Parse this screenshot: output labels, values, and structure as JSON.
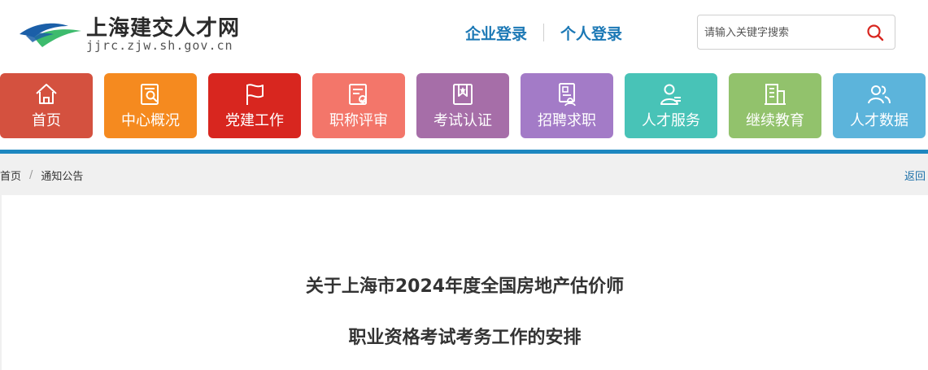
{
  "site": {
    "title": "上海建交人才网",
    "domain": "jjrc.zjw.sh.gov.cn"
  },
  "header": {
    "enterprise_login": "企业登录",
    "personal_login": "个人登录",
    "search_placeholder": "请输入关键字搜索"
  },
  "nav": {
    "items": [
      {
        "label": "首页",
        "icon": "home-icon",
        "color": "#d4513f"
      },
      {
        "label": "中心概况",
        "icon": "document-search-icon",
        "color": "#f58a1f"
      },
      {
        "label": "党建工作",
        "icon": "flag-icon",
        "color": "#d8261f"
      },
      {
        "label": "职称评审",
        "icon": "certificate-icon",
        "color": "#f3766a"
      },
      {
        "label": "考试认证",
        "icon": "badge-star-icon",
        "color": "#a66ea8"
      },
      {
        "label": "招聘求职",
        "icon": "resume-icon",
        "color": "#a37bc7"
      },
      {
        "label": "人才服务",
        "icon": "user-service-icon",
        "color": "#48c3b7"
      },
      {
        "label": "继续教育",
        "icon": "building-icon",
        "color": "#92c26c"
      },
      {
        "label": "人才数据",
        "icon": "users-icon",
        "color": "#5cb4db"
      }
    ]
  },
  "breadcrumb": {
    "home": "首页",
    "separator": "/",
    "current": "通知公告",
    "back": "返回"
  },
  "article": {
    "title_line1": "关于上海市2024年度全国房地产估价师",
    "title_line2": "职业资格考试考务工作的安排"
  },
  "colors": {
    "accent_blue": "#1d87c0",
    "link_blue": "#1b78b5"
  }
}
